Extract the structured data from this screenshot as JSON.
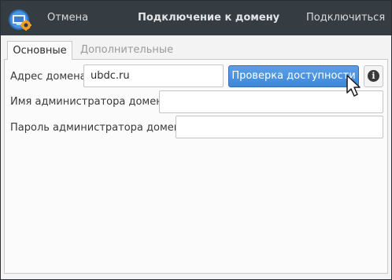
{
  "titlebar": {
    "cancel_label": "Отмена",
    "title": "Подключение к домену",
    "connect_label": "Подключиться",
    "app_icon": "domain-connect-icon"
  },
  "tabs": [
    {
      "label": "Основные",
      "active": true
    },
    {
      "label": "Дополнительные",
      "active": false
    }
  ],
  "form": {
    "domain_address": {
      "label": "Адрес домена:",
      "value": "ubdc.ru"
    },
    "check_button_label": "Проверка доступности",
    "info_button_icon": "info-icon",
    "admin_name": {
      "label": "Имя администратора домена:",
      "value": ""
    },
    "admin_password": {
      "label": "Пароль администратора домена:",
      "value": ""
    }
  },
  "colors": {
    "titlebar_bg": "#353c42",
    "accent": "#4a93e0"
  }
}
